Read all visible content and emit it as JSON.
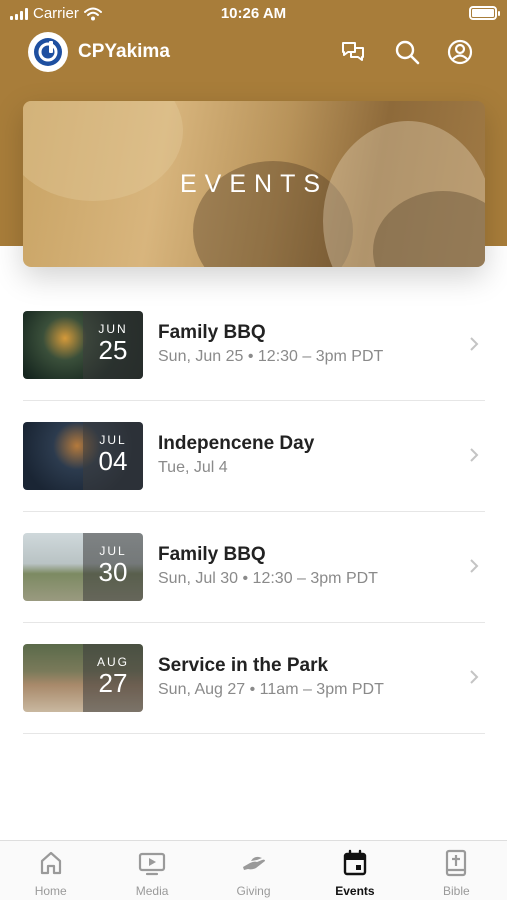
{
  "status_bar": {
    "carrier": "Carrier",
    "time": "10:26 AM"
  },
  "app": {
    "title": "CPYakima",
    "accent": "#a87d3a"
  },
  "top_icons": [
    "chat-icon",
    "search-icon",
    "profile-icon"
  ],
  "hero": {
    "title": "EVENTS"
  },
  "events": [
    {
      "title": "Family BBQ",
      "subtitle": "Sun, Jun 25 • 12:30 – 3pm PDT",
      "month": "JUN",
      "day": "25"
    },
    {
      "title": "Indepencene Day",
      "subtitle": "Tue, Jul 4",
      "month": "JUL",
      "day": "04"
    },
    {
      "title": "Family BBQ",
      "subtitle": "Sun, Jul 30 • 12:30 – 3pm PDT",
      "month": "JUL",
      "day": "30"
    },
    {
      "title": "Service in the Park",
      "subtitle": "Sun, Aug 27 • 11am – 3pm PDT",
      "month": "AUG",
      "day": "27"
    }
  ],
  "tabs": [
    {
      "label": "Home",
      "icon": "home-icon",
      "active": false
    },
    {
      "label": "Media",
      "icon": "media-icon",
      "active": false
    },
    {
      "label": "Giving",
      "icon": "giving-icon",
      "active": false
    },
    {
      "label": "Events",
      "icon": "calendar-icon",
      "active": true
    },
    {
      "label": "Bible",
      "icon": "bible-icon",
      "active": false
    }
  ]
}
